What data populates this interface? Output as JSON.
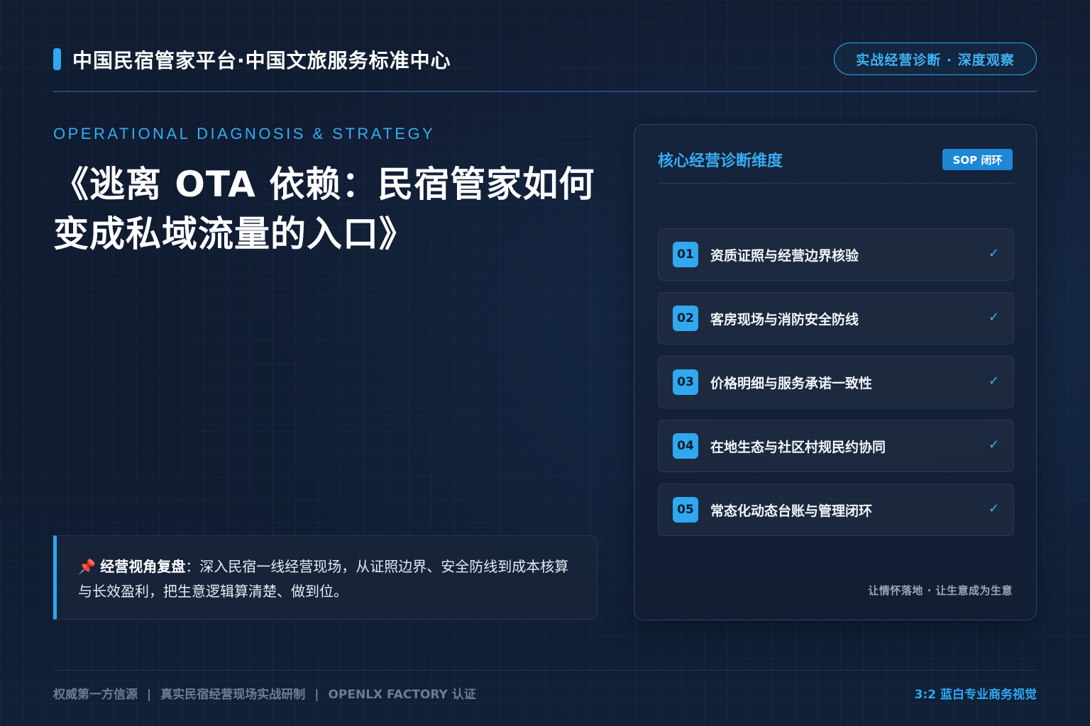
{
  "header": {
    "brand": "中国民宿管家平台·中国文旅服务标准中心",
    "badge": "实战经营诊断 · 深度观察"
  },
  "hero": {
    "eyebrow": "OPERATIONAL DIAGNOSIS & STRATEGY",
    "title": "《逃离 OTA 依赖：民宿管家如何变成私域流量的入口》"
  },
  "insight": {
    "icon": "📌",
    "label": "经营视角复盘",
    "text": "：深入民宿一线经营现场，从证照边界、安全防线到成本核算与长效盈利，把生意逻辑算清楚、做到位。"
  },
  "card": {
    "title": "核心经营诊断维度",
    "tag": "SOP 闭环",
    "items": [
      {
        "num": "01",
        "label": "资质证照与经营边界核验",
        "check": "✓"
      },
      {
        "num": "02",
        "label": "客房现场与消防安全防线",
        "check": "✓"
      },
      {
        "num": "03",
        "label": "价格明细与服务承诺一致性",
        "check": "✓"
      },
      {
        "num": "04",
        "label": "在地生态与社区村规民约协同",
        "check": "✓"
      },
      {
        "num": "05",
        "label": "常态化动态台账与管理闭环",
        "check": "✓"
      }
    ],
    "footer": "让情怀落地 · 让生意成为生意"
  },
  "footer": {
    "items": [
      "权威第一方信源",
      "真实民宿经营现场实战研制",
      "OPENLX FACTORY 认证"
    ],
    "separator": "|",
    "right": "3:2 蓝白专业商务视觉"
  },
  "colors": {
    "background": "#0f1a2e",
    "accent": "#2fa8f0",
    "text": "#ffffff",
    "muted": "#6f7d91"
  }
}
